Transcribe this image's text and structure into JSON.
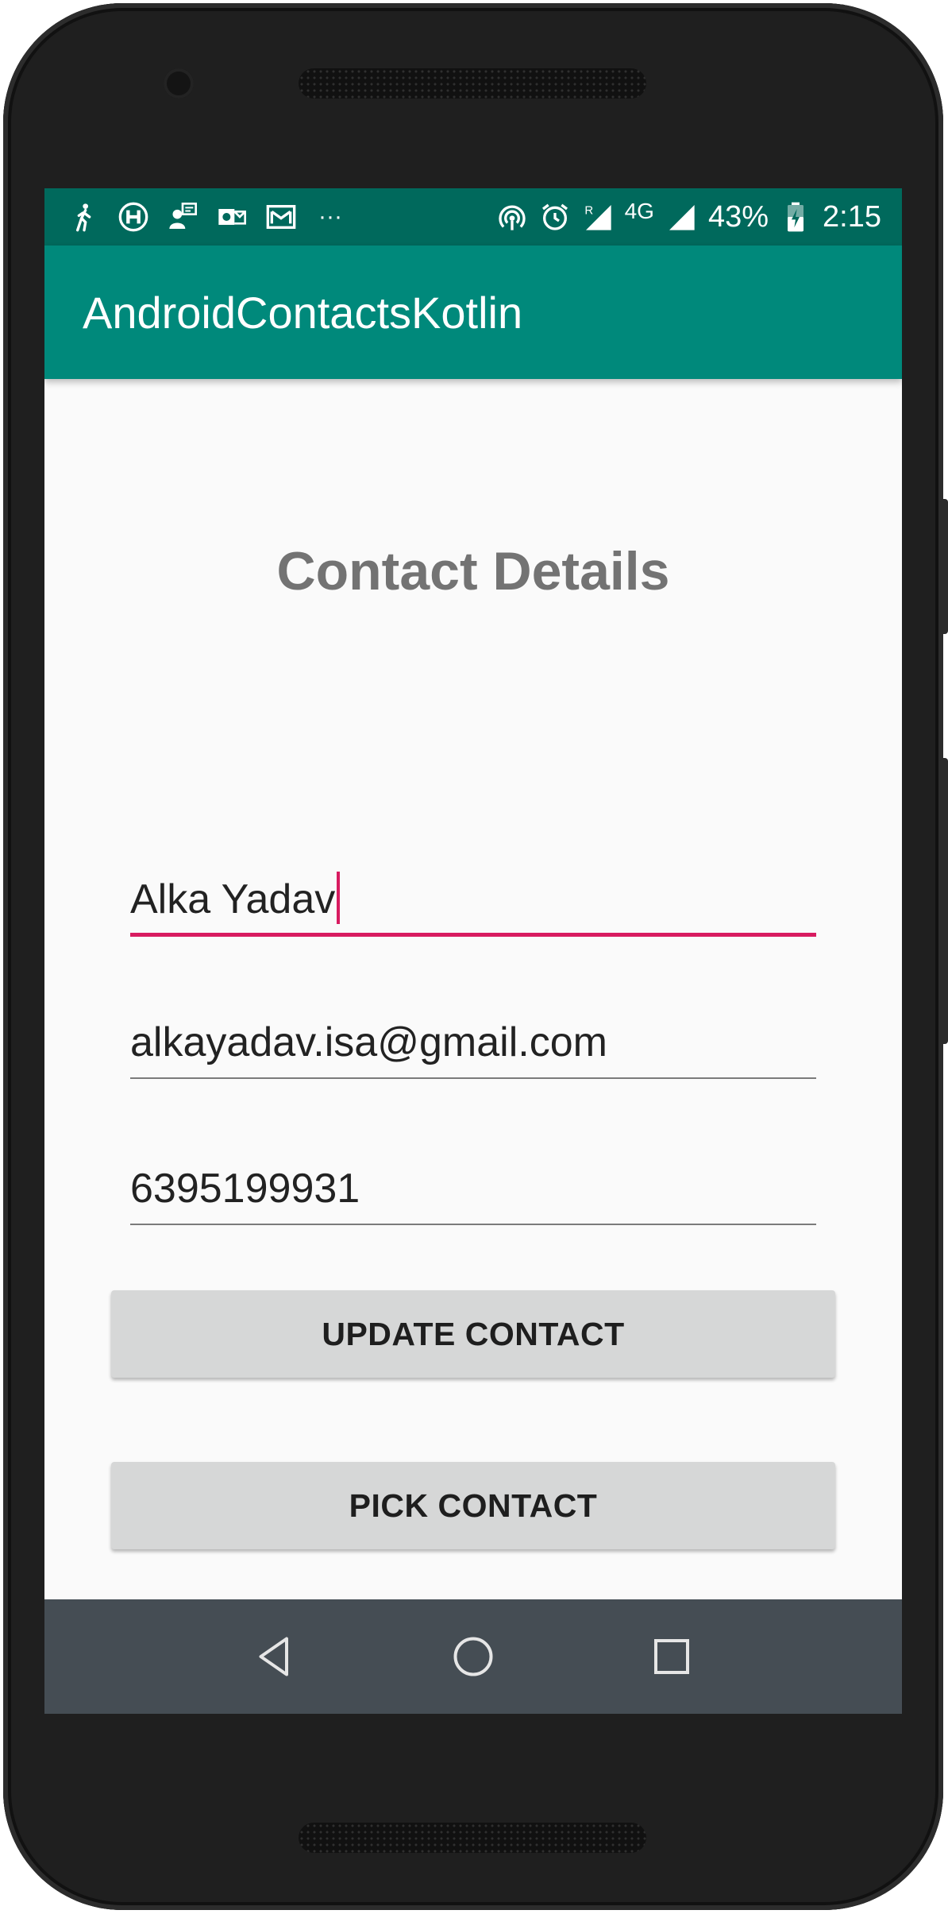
{
  "status_bar": {
    "icons": [
      "walking-icon",
      "hospital-icon",
      "contact-card-icon",
      "outlook-icon",
      "gmail-icon",
      "more-dots-icon",
      "hotspot-icon",
      "alarm-icon",
      "roaming-signal-icon",
      "signal-icon",
      "battery-charging-icon"
    ],
    "overflow": "···",
    "network": "4G",
    "battery": "43%",
    "time": "2:15"
  },
  "app_bar": {
    "title": "AndroidContactsKotlin"
  },
  "main": {
    "heading": "Contact Details",
    "name_value": "Alka Yadav",
    "email_value": "alkayadav.isa@gmail.com",
    "phone_value": "6395199931",
    "update_button": "UPDATE CONTACT",
    "pick_button": "PICK CONTACT"
  },
  "nav_bar": {
    "icons": [
      "back-icon",
      "home-icon",
      "recents-icon"
    ]
  },
  "colors": {
    "status_bar": "#00695c",
    "app_bar": "#00897b",
    "accent": "#d81b60",
    "background": "#fafafa",
    "button": "#d6d7d7",
    "nav_bar": "#454d54"
  }
}
